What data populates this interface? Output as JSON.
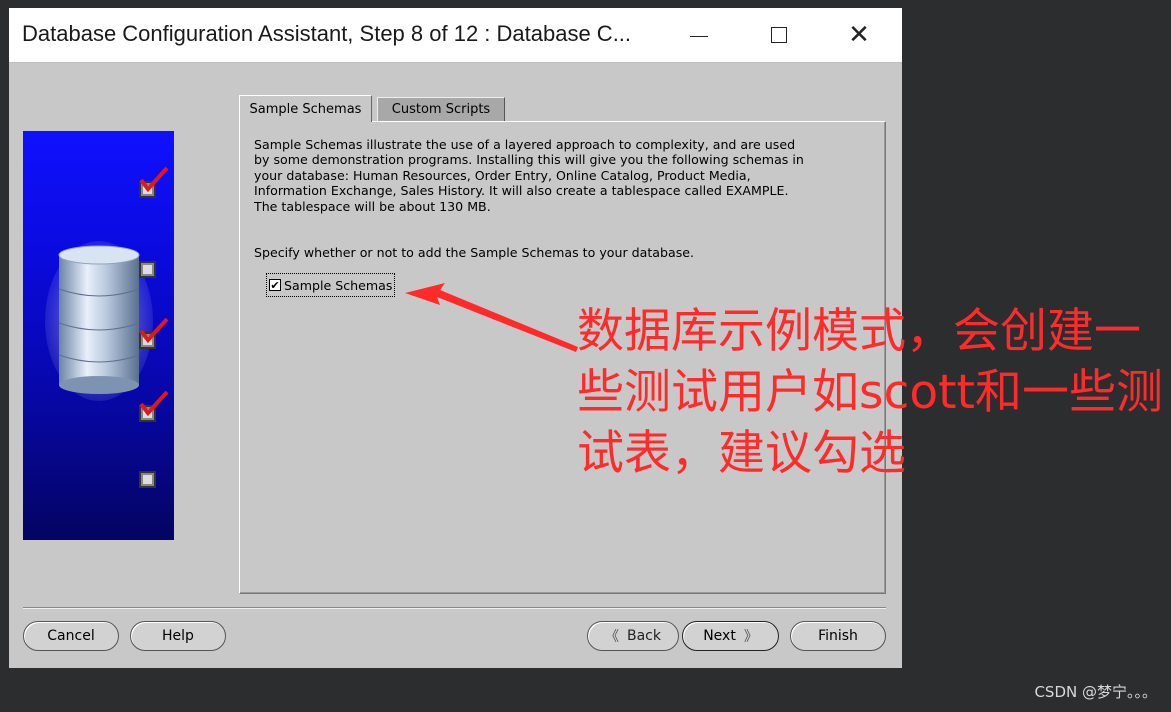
{
  "window": {
    "title": "Database Configuration Assistant, Step 8 of 12 : Database C...",
    "controls": {
      "minimize": "minimize",
      "maximize": "maximize",
      "close": "close"
    }
  },
  "side_panel": {
    "steps_completed": [
      true,
      false,
      true,
      true,
      false
    ]
  },
  "tabs": [
    {
      "label": "Sample Schemas",
      "active": true
    },
    {
      "label": "Custom Scripts",
      "active": false
    }
  ],
  "content": {
    "description": "Sample Schemas illustrate the use of a layered approach to complexity, and are used\nby some demonstration programs. Installing this will give you the following schemas in\nyour database: Human Resources, Order Entry, Online Catalog, Product Media,\nInformation Exchange, Sales History. It will also create a tablespace called EXAMPLE.\nThe tablespace will be about 130 MB.",
    "specify_text": "Specify whether or not to add the Sample Schemas to your database.",
    "checkbox_label": "Sample Schemas",
    "checkbox_checked": true
  },
  "buttons": {
    "cancel": "Cancel",
    "help": "Help",
    "back": "Back",
    "next": "Next",
    "finish": "Finish"
  },
  "annotation": {
    "text": "数据库示例模式，会创建一些测试用户如scott和一些测试表，建议勾选",
    "color": "#ff2b2b"
  },
  "watermark": "CSDN @梦宁。。。"
}
